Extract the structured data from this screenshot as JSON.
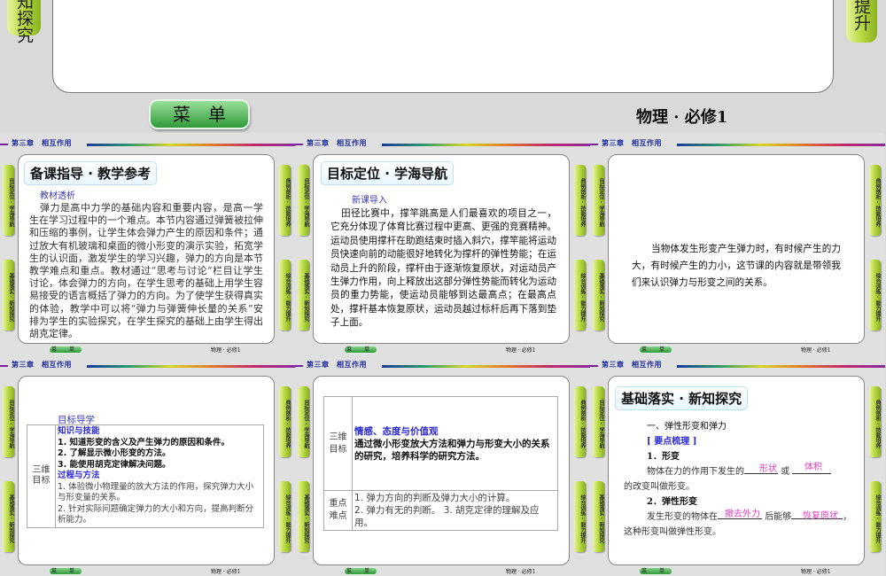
{
  "chrome": {
    "chapter": "第三章　相互作用",
    "menu": "菜 单",
    "book": "物理 · 必修1",
    "left_tabs": [
      "目标定位·学海导航",
      "基础落实·新知探究"
    ],
    "right_tabs": [
      "典例剖析·技能培养",
      "综合训练·能力提升"
    ]
  },
  "top_slide": {
    "left_tab_fragment": "知探究",
    "right_tab_fragment": "力提升",
    "menu": "菜　单",
    "book": "物理 · 必修1"
  },
  "slide1": {
    "title": "备课指导 · 教学参考",
    "subhead": "教材透析",
    "body": "弹力是高中力学的基础内容和重要内容，是高一学生在学习过程中的一个难点。本节内容通过弹簧被拉伸和压缩的事例，让学生体会弹力产生的原因和条件；通过放大有机玻璃和桌面的微小形变的演示实验，拓宽学生的认识面，激发学生的学习兴趣，弹力的方向是本节教学难点和重点。教材通过“思考与讨论”栏目让学生讨论，体会弹力的方向，在学生思考的基础上用学生容易接受的语言概括了弹力的方向。为了使学生获得真实的体验，教学中可以将“弹力与弹簧伸长量的关系”安排为学生的实验探究，在学生探究的基础上由学生得出胡克定律。"
  },
  "slide2": {
    "title": "目标定位 · 学海导航",
    "subhead": "新课导入",
    "body": "田径比赛中，撑竿跳高是人们最喜欢的项目之一，它充分体现了体育比赛过程中更高、更强的竞赛精神。运动员使用撑杆在助跑结束时插入斜穴，撑竿能将运动员快速向前的动能很好地转化为撑杆的弹性势能；在运动员上升的阶段，撑杆由于逐渐恢复原状，对运动员产生弹力作用，向上释放出这部分弹性势能而转化为运动员的重力势能，使运动员能够到达最高点；在最高点处，撑杆基本恢复原状，运动员越过标杆后再下落到垫子上面。"
  },
  "slide3": {
    "body": "当物体发生形变产生弹力时，有时候产生的力大，有时候产生的力小，这节课的内容就是带领我们来认识弹力与形变之间的关系。"
  },
  "slide4": {
    "subhead": "目标导学",
    "row_label": "三维目标",
    "h1": "知识与技能",
    "k1": "1. 知道形变的含义及产生弹力的原因和条件。",
    "k2": "2. 了解显示微小形变的方法。",
    "k3": "3. 能使用胡克定律解决问题。",
    "h2": "过程与方法",
    "m1": "1. 体验微小物理量的放大方法的作用，探究弹力大小与形变量的关系。",
    "m2": "2. 针对实际问题确定弹力的大小和方向，提高判断分析能力。"
  },
  "slide5": {
    "row1_label": "三维目标",
    "h": "情感、态度与价值观",
    "t": "通过微小形变放大方法和弹力与形变大小的关系的研究，培养科学的研究方法。",
    "row2_label": "重点难点",
    "p1": "1. 弹力方向的判断及弹力大小的计算。",
    "p2": "2. 弹力有无的判断。 3. 胡克定律的理解及应用。"
  },
  "slide6": {
    "title": "基础落实 · 新知探究",
    "s1": "一、弹性形变和弹力",
    "s2": "[ 要点梳理 ]",
    "s3": "1．形变",
    "s4a": "物体在力的作用下发生的",
    "s4b": "或",
    "s4c": "的改变叫做形变。",
    "a1": "形状",
    "a2": "体积",
    "s5": "2．弹性形变",
    "s6a": "发生形变的物体在",
    "s6b": "后能够",
    "a3": "撤去外力",
    "a4": "恢复原状",
    "s7": "这种形变叫做弹性形变。"
  }
}
